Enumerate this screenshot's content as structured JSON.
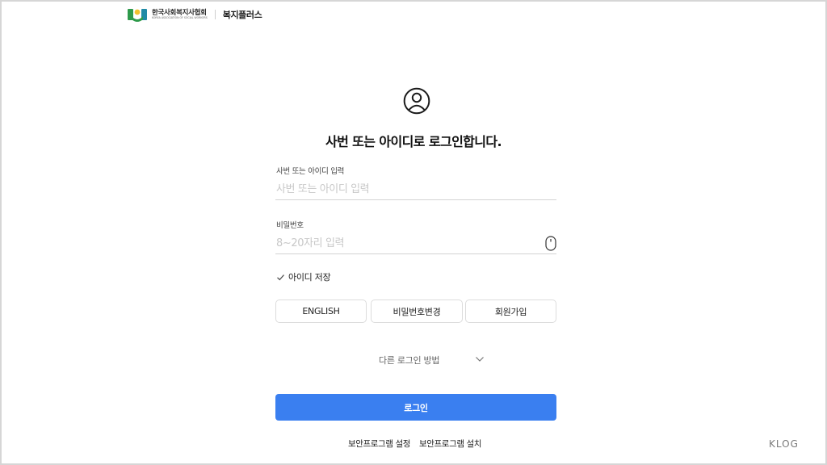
{
  "header": {
    "org_name": "한국사회복지사협회",
    "org_name_en": "KOREA ASSOCIATION OF SOCIAL WORKERS",
    "service_name": "복지플러스"
  },
  "login": {
    "title": "사번 또는 아이디로 로그인합니다.",
    "id_label": "사번 또는 아이디 입력",
    "id_placeholder": "사번 또는 아이디 입력",
    "id_value": "",
    "password_label": "비밀번호",
    "password_placeholder": "8~20자리 입력",
    "password_value": "",
    "save_id_label": "아이디 저장",
    "buttons": {
      "english": "ENGLISH",
      "change_password": "비밀번호변경",
      "signup": "회원가입"
    },
    "other_login": "다른 로그인 방법",
    "submit": "로그인"
  },
  "footer": {
    "security_settings": "보안프로그램 설정",
    "security_install": "보안프로그램 설치"
  },
  "watermark": "KLOG",
  "colors": {
    "primary": "#3a7ff0",
    "logo_green": "#2e9a4b",
    "logo_yellow": "#f2c230",
    "logo_teal": "#1f8aa6"
  },
  "icons": {
    "user": "user-circle-icon",
    "mouse": "mouse-icon",
    "check": "check-icon",
    "chevron": "chevron-down-icon"
  }
}
